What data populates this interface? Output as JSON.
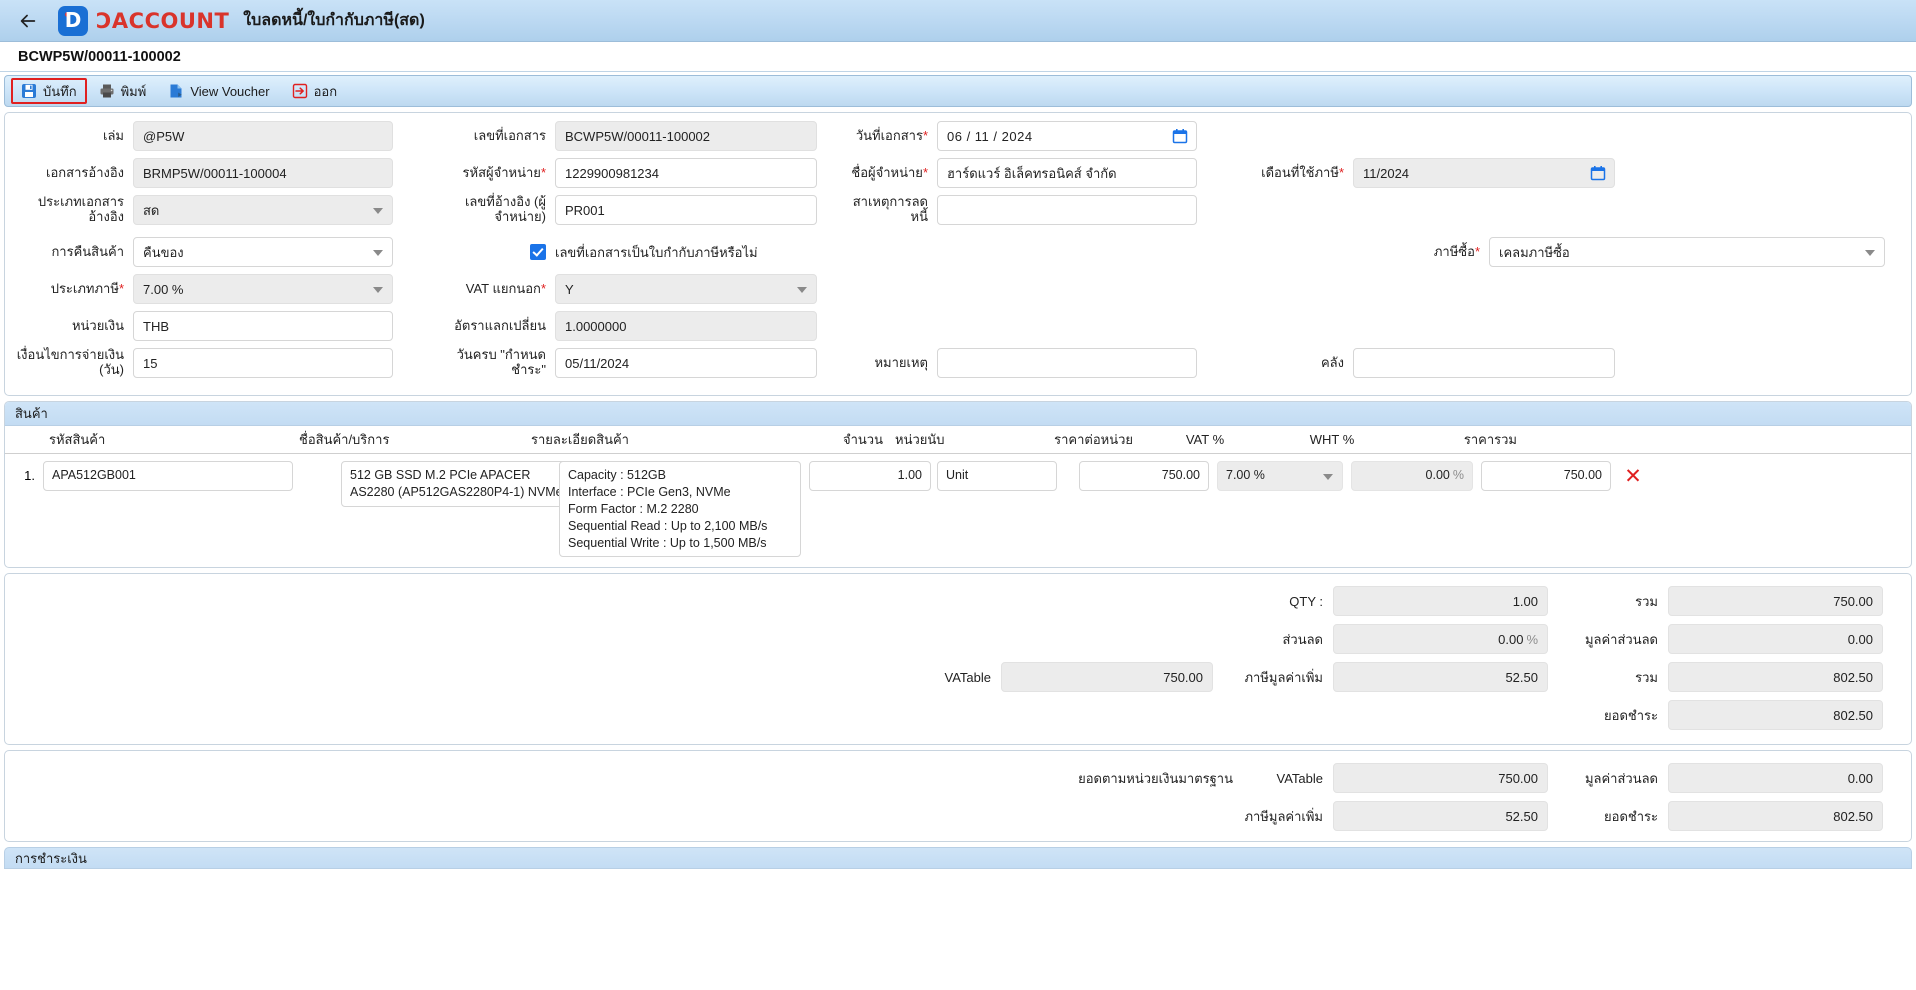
{
  "header": {
    "back_icon": "back-arrow-icon",
    "brand": "ƆACCOUNT",
    "doc_type_title": "ใบลดหนี้/ใบกำกับภาษี(สด)",
    "document_number": "BCWP5W/00011-100002"
  },
  "toolbar": {
    "items": [
      {
        "label": "บันทึก",
        "icon": "save-icon"
      },
      {
        "label": "พิมพ์",
        "icon": "printer-icon"
      },
      {
        "label": "View Voucher",
        "icon": "voucher-icon"
      },
      {
        "label": "ออก",
        "icon": "exit-icon"
      }
    ]
  },
  "form": {
    "book": {
      "label": "เล่ม",
      "value": "@P5W"
    },
    "doc_no": {
      "label": "เลขที่เอกสาร",
      "value": "BCWP5W/00011-100002"
    },
    "doc_date": {
      "label": "วันที่เอกสาร",
      "required": true,
      "value": "06 / 11 / 2024"
    },
    "ref_doc": {
      "label": "เอกสารอ้างอิง",
      "value": "BRMP5W/00011-100004"
    },
    "vendor_code": {
      "label": "รหัสผู้จำหน่าย",
      "required": true,
      "value": "1229900981234"
    },
    "vendor_name": {
      "label": "ชื่อผู้จำหน่าย",
      "required": true,
      "value": "ฮาร์ดแวร์ อิเล็คทรอนิคส์ จำกัด"
    },
    "tax_month": {
      "label": "เดือนที่ใช้ภาษี",
      "required": true,
      "value": "11/2024"
    },
    "ref_doc_type": {
      "label": "ประเภทเอกสารอ้างอิง",
      "value": "สด"
    },
    "vendor_ref_no": {
      "label": "เลขที่อ้างอิง (ผู้จำหน่าย)",
      "label_line1": "เลขที่อ้างอิง (ผู้",
      "label_line2": "จำหน่าย)",
      "value": "PR001"
    },
    "credit_reason": {
      "label": "สาเหตุการลดหนี้",
      "value": ""
    },
    "return_goods": {
      "label": "การคืนสินค้า",
      "value": "คืนของ"
    },
    "is_tax_invoice": {
      "label": "เลขที่เอกสารเป็นใบกำกับภาษีหรือไม่",
      "checked": true
    },
    "purchase_tax": {
      "label": "ภาษีซื้อ",
      "required": true,
      "value": "เคลมภาษีซื้อ"
    },
    "tax_type": {
      "label": "ประเภทภาษี",
      "required": true,
      "value": "7.00 %"
    },
    "vat_separate": {
      "label": "VAT แยกนอก",
      "required": true,
      "value": "Y"
    },
    "currency": {
      "label": "หน่วยเงิน",
      "value": "THB"
    },
    "exchange_rate": {
      "label": "อัตราแลกเปลี่ยน",
      "value": "1.0000000"
    },
    "payment_terms": {
      "label": "เงื่อนไขการจ่ายเงิน (วัน)",
      "label_line1": "เงื่อนไขการจ่ายเงิน",
      "label_line2": "(วัน)",
      "value": "15"
    },
    "due_date": {
      "label": "วันครบ \"กำหนดชำระ\"",
      "value": "05/11/2024"
    },
    "remark": {
      "label": "หมายเหตุ",
      "value": ""
    },
    "warehouse": {
      "label": "คลัง",
      "value": ""
    }
  },
  "items_section": {
    "title": "สินค้า",
    "columns": {
      "code": "รหัสสินค้า",
      "name": "ชื่อสินค้า/บริการ",
      "description": "รายละเอียดสินค้า",
      "qty": "จำนวน",
      "unit": "หน่วยนับ",
      "unit_price": "ราคาต่อหน่วย",
      "vat_pct": "VAT %",
      "wht_pct": "WHT %",
      "total": "ราคารวม"
    },
    "rows": [
      {
        "index": "1.",
        "code": "APA512GB001",
        "name": "512 GB SSD M.2 PCIe APACER AS2280 (AP512GAS2280P4-1) NVMe",
        "description": "Capacity : 512GB\nInterface : PCIe Gen3, NVMe\nForm Factor : M.2 2280\nSequential Read : Up to 2,100 MB/s\nSequential Write : Up to 1,500 MB/s",
        "qty": "1.00",
        "unit": "Unit",
        "unit_price": "750.00",
        "vat_pct": "7.00 %",
        "wht_pct": "0.00",
        "wht_suffix": "%",
        "total": "750.00",
        "delete_icon": "delete-x-icon"
      }
    ]
  },
  "totals": {
    "qty_label": "QTY :",
    "qty_value": "1.00",
    "sum_label": "รวม",
    "sum_value": "750.00",
    "discount_label": "ส่วนลด",
    "discount_value": "0.00",
    "discount_suffix": "%",
    "discount_amount_label": "มูลค่าส่วนลด",
    "discount_amount_value": "0.00",
    "vatable_label": "VATable",
    "vatable_value": "750.00",
    "vat_label": "ภาษีมูลค่าเพิ่ม",
    "vat_value": "52.50",
    "sum2_label": "รวม",
    "sum2_value": "802.50",
    "net_label": "ยอดชำระ",
    "net_value": "802.50"
  },
  "base_currency_totals": {
    "title": "ยอดตามหน่วยเงินมาตรฐาน",
    "vatable_label": "VATable",
    "vatable_value": "750.00",
    "discount_amount_label": "มูลค่าส่วนลด",
    "discount_amount_value": "0.00",
    "vat_label": "ภาษีมูลค่าเพิ่ม",
    "vat_value": "52.50",
    "net_label": "ยอดชำระ",
    "net_value": "802.50"
  },
  "payment_section": {
    "title": "การชำระเงิน"
  },
  "colors": {
    "header_blue": "#bcd9f2",
    "brand_red": "#d9342b",
    "accent_blue": "#1a73e8",
    "required_red": "#e02020"
  }
}
